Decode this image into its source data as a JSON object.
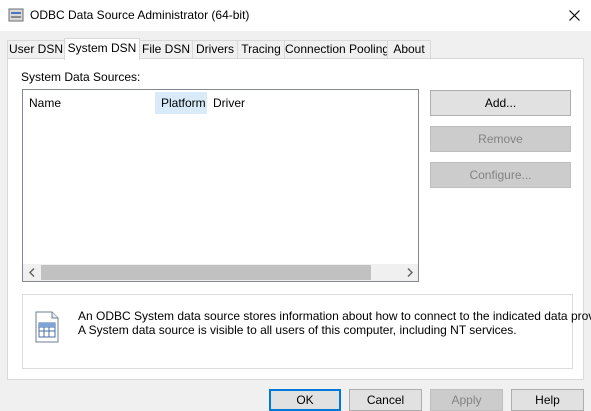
{
  "window": {
    "title": "ODBC Data Source Administrator (64-bit)",
    "close_glyph": "✕"
  },
  "tabs": [
    {
      "label": "User DSN",
      "active": false
    },
    {
      "label": "System DSN",
      "active": true
    },
    {
      "label": "File DSN",
      "active": false
    },
    {
      "label": "Drivers",
      "active": false
    },
    {
      "label": "Tracing",
      "active": false
    },
    {
      "label": "Connection Pooling",
      "active": false
    },
    {
      "label": "About",
      "active": false
    }
  ],
  "system_dsn": {
    "section_label": "System Data Sources:",
    "columns": [
      "Name",
      "Platform",
      "Driver"
    ],
    "rows": [],
    "side_buttons": {
      "add": {
        "label": "Add...",
        "enabled": true
      },
      "remove": {
        "label": "Remove",
        "enabled": false
      },
      "configure": {
        "label": "Configure...",
        "enabled": false
      }
    },
    "info": {
      "line1": "An ODBC System data source stores information about how to connect to the indicated data provider.",
      "line2": "A System data source is visible to all users of this computer, including NT services."
    }
  },
  "footer_buttons": {
    "ok": "OK",
    "cancel": "Cancel",
    "apply": "Apply",
    "help": "Help"
  },
  "colors": {
    "accent": "#0078d7",
    "hover_header": "#d9ebf9",
    "disabled_text": "#838383"
  },
  "icons": [
    "app-icon",
    "close-icon",
    "scroll-left-icon",
    "scroll-right-icon",
    "datasource-info-icon"
  ]
}
